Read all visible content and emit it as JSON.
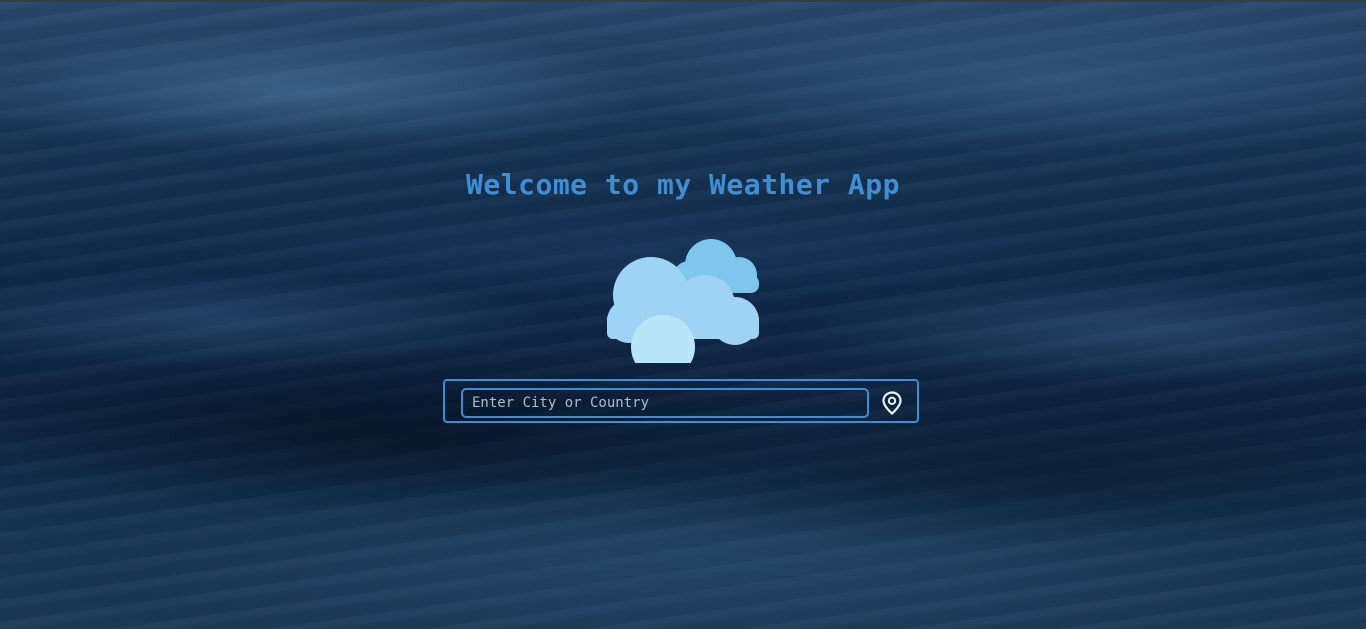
{
  "app": {
    "title": "Welcome to my Weather App"
  },
  "weather_icon": {
    "icon": "cloudy-icon",
    "colors": [
      "#7fc6ef",
      "#9fd3f5",
      "#b8e6f8"
    ]
  },
  "search": {
    "placeholder": "Enter City or Country",
    "value": ""
  },
  "location_button": {
    "icon": "map-pin-icon"
  },
  "theme": {
    "accent": "#3f8ed4"
  }
}
